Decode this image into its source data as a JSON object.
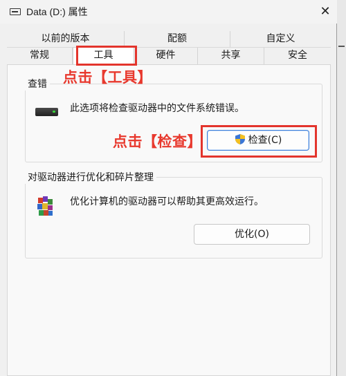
{
  "window": {
    "title": "Data (D:) 属性",
    "close_glyph": "✕"
  },
  "tabs": {
    "row1": [
      "以前的版本",
      "配额",
      "自定义"
    ],
    "row2": [
      "常规",
      "工具",
      "硬件",
      "共享",
      "安全"
    ],
    "active": "工具"
  },
  "error_check": {
    "group_title": "查错",
    "description": "此选项将检查驱动器中的文件系统错误。",
    "button_label": "检查(C)"
  },
  "optimize": {
    "group_title": "对驱动器进行优化和碎片整理",
    "description": "优化计算机的驱动器可以帮助其更高效运行。",
    "button_label": "优化(O)"
  },
  "annotations": {
    "click_tools": "点击【工具】",
    "click_check": "点击【检查】",
    "color": "#e3342c"
  },
  "icons": [
    "window-icon",
    "close-icon",
    "drive-icon",
    "shield-icon",
    "defrag-icon"
  ]
}
